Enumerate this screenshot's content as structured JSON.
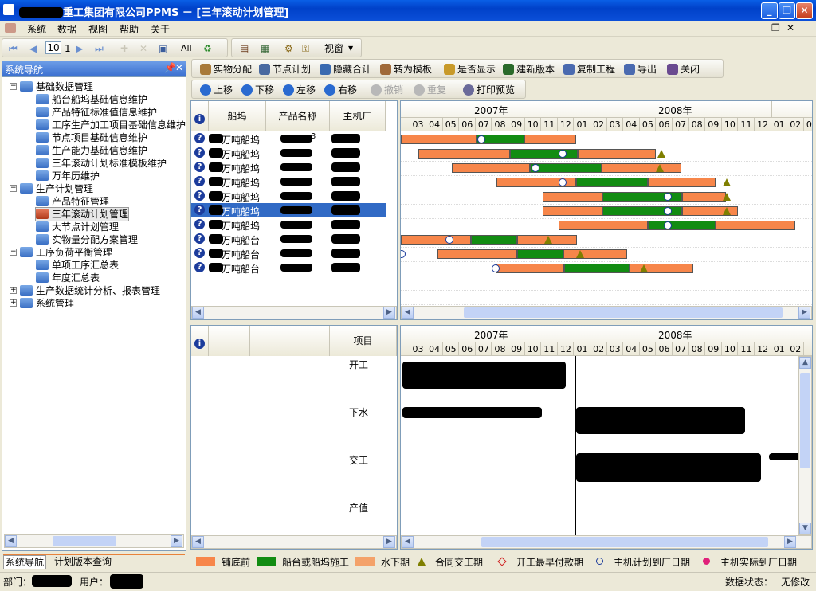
{
  "window": {
    "title": "重工集团有限公司PPMS － [三年滚动计划管理]"
  },
  "menu": [
    "系统",
    "数据",
    "视图",
    "帮助",
    "关于"
  ],
  "toolbar1": {
    "page_box": "10",
    "page_num": "1",
    "all_label": "All",
    "view_label": "视窗"
  },
  "toolbar2": [
    "实物分配",
    "节点计划",
    "隐藏合计",
    "转为模板",
    "是否显示",
    "建新版本",
    "复制工程",
    "导出",
    "关闭"
  ],
  "toolbar3": [
    "上移",
    "下移",
    "左移",
    "右移",
    "撤销",
    "重复",
    "打印预览"
  ],
  "nav": {
    "title": "系统导航",
    "pin": "ᵖ",
    "groups": [
      {
        "label": "基础数据管理",
        "items": [
          "船台船坞基础信息维护",
          "产品特征标准值信息维护",
          "工序生产加工项目基础信息维护",
          "节点项目基础信息维护",
          "生产能力基础信息维护",
          "三年滚动计划标准模板维护",
          "万年历维护"
        ]
      },
      {
        "label": "生产计划管理",
        "items": [
          "产品特征管理",
          "三年滚动计划管理",
          "大节点计划管理",
          "实物量分配方案管理"
        ]
      },
      {
        "label": "工序负荷平衡管理",
        "items": [
          "单项工序汇总表",
          "年度汇总表"
        ]
      },
      {
        "label": "生产数据统计分析、报表管理",
        "items": []
      },
      {
        "label": "系统管理",
        "items": []
      }
    ],
    "tabs": [
      "系统导航",
      "计划版本查询"
    ]
  },
  "grid": {
    "headers": [
      "船坞",
      "产品名称",
      "主机厂"
    ],
    "rows": [
      {
        "dock": "万吨船坞",
        "name": "3"
      },
      {
        "dock": "万吨船坞",
        "name": ""
      },
      {
        "dock": "万吨船坞",
        "name": ""
      },
      {
        "dock": "万吨船坞",
        "name": ""
      },
      {
        "dock": "万吨船坞",
        "name": ""
      },
      {
        "dock": "万吨船坞",
        "name": ""
      },
      {
        "dock": "万吨船坞",
        "name": ""
      },
      {
        "dock": "万吨船台",
        "name": ""
      },
      {
        "dock": "万吨船台",
        "name": ""
      },
      {
        "dock": "万吨船台",
        "name": ""
      }
    ]
  },
  "gantt": {
    "years": [
      "2007年",
      "2008年"
    ],
    "months": [
      "03",
      "04",
      "05",
      "06",
      "07",
      "08",
      "09",
      "10",
      "11",
      "12",
      "01",
      "02",
      "03",
      "04",
      "05",
      "06",
      "07",
      "08",
      "09",
      "10",
      "11",
      "12",
      "01",
      "02",
      "03"
    ]
  },
  "lower": {
    "header": "项目",
    "rows": [
      "开工",
      "下水",
      "交工",
      "产值"
    ],
    "months": [
      "03",
      "04",
      "05",
      "06",
      "07",
      "08",
      "09",
      "10",
      "11",
      "12",
      "01",
      "02",
      "03",
      "04",
      "05",
      "06",
      "07",
      "08",
      "09",
      "10",
      "11",
      "12",
      "01",
      "02"
    ]
  },
  "legend": [
    "铺底前",
    "船台或船坞施工",
    "水下期",
    "合同交工期",
    "开工最早付款期",
    "主机计划到厂日期",
    "主机实际到厂日期"
  ],
  "status": {
    "dept_label": "部门：",
    "user_label": "用户：",
    "data_state_label": "数据状态：",
    "data_state": "无修改"
  },
  "colors": {
    "orange": "#f7864a",
    "green": "#128c12",
    "selected": "#316ac5"
  }
}
